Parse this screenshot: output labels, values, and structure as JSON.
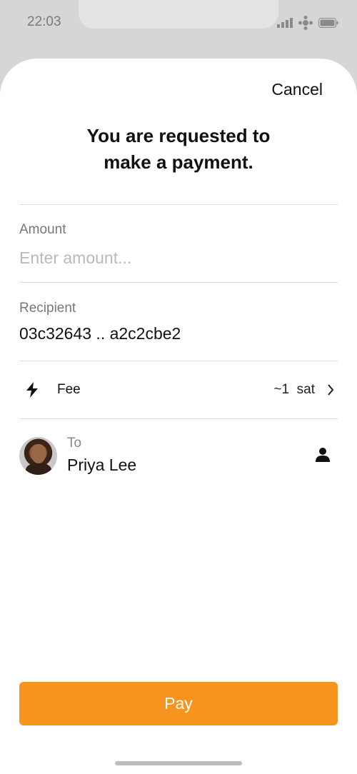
{
  "status_bar": {
    "time": "22:03",
    "icons": [
      "signal-icon",
      "network-icon",
      "battery-icon"
    ]
  },
  "header": {
    "cancel_label": "Cancel",
    "title_line1": "You are requested to",
    "title_line2": "make a payment."
  },
  "amount": {
    "label": "Amount",
    "placeholder": "Enter amount...",
    "value": ""
  },
  "recipient": {
    "label": "Recipient",
    "value": "03c32643 .. a2c2cbe2"
  },
  "fee": {
    "icon": "lightning-icon",
    "label": "Fee",
    "value": "~1  sat",
    "chevron": "chevron-right-icon"
  },
  "to": {
    "label": "To",
    "name": "Priya Lee",
    "contact_icon": "person-icon"
  },
  "pay_button": {
    "label": "Pay"
  },
  "colors": {
    "accent": "#f7941d",
    "background_gray": "#d6d6d6",
    "divider": "#dcdcdc",
    "text_primary": "#111111",
    "text_secondary": "#777777",
    "placeholder": "#b9b9b9"
  }
}
